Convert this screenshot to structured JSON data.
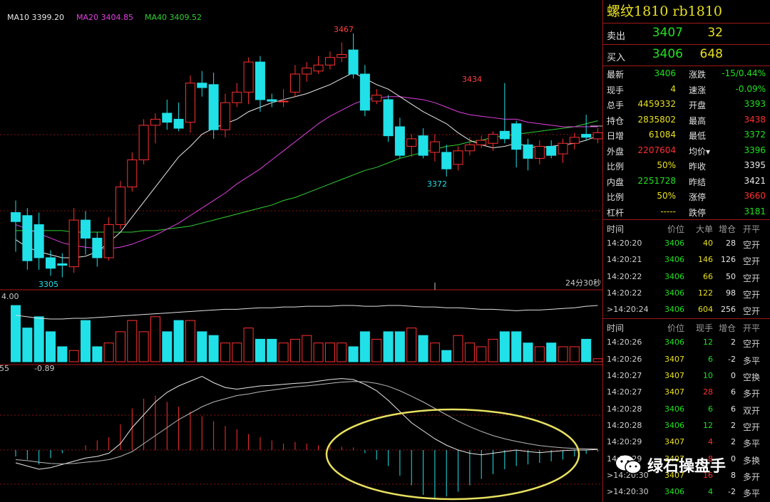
{
  "ma_labels": {
    "ma10": "MA10 3399.20",
    "ma20": "MA20 3404.85",
    "ma40": "MA40 3409.52"
  },
  "price_labels": {
    "high": "3467",
    "peak2": "3434",
    "low_mid": "3372",
    "low": "3305",
    "time_left": "24分30秒"
  },
  "volume_label": "4.00",
  "macd_labels": {
    "left": "55",
    "value": "-0.89"
  },
  "colors": {
    "up": "#ff3030",
    "down": "#20e0e8",
    "ma10": "#e8e8e8",
    "ma20": "#e040e0",
    "ma40": "#30d030",
    "grid": "#8a1010",
    "ellipse": "#e8e060"
  },
  "chart_data": {
    "type": "candlestick",
    "ylim": [
      3300,
      3475
    ],
    "candles": [
      {
        "o": 3348,
        "h": 3356,
        "l": 3322,
        "c": 3342
      },
      {
        "o": 3346,
        "h": 3351,
        "l": 3310,
        "c": 3316
      },
      {
        "o": 3340,
        "h": 3348,
        "l": 3310,
        "c": 3318
      },
      {
        "o": 3318,
        "h": 3323,
        "l": 3306,
        "c": 3311
      },
      {
        "o": 3314,
        "h": 3321,
        "l": 3305,
        "c": 3313
      },
      {
        "o": 3312,
        "h": 3351,
        "l": 3308,
        "c": 3343
      },
      {
        "o": 3343,
        "h": 3349,
        "l": 3320,
        "c": 3331
      },
      {
        "o": 3331,
        "h": 3335,
        "l": 3312,
        "c": 3318
      },
      {
        "o": 3318,
        "h": 3345,
        "l": 3316,
        "c": 3340
      },
      {
        "o": 3340,
        "h": 3369,
        "l": 3337,
        "c": 3365
      },
      {
        "o": 3365,
        "h": 3388,
        "l": 3362,
        "c": 3383
      },
      {
        "o": 3383,
        "h": 3410,
        "l": 3380,
        "c": 3406
      },
      {
        "o": 3406,
        "h": 3414,
        "l": 3394,
        "c": 3410
      },
      {
        "o": 3414,
        "h": 3423,
        "l": 3403,
        "c": 3408
      },
      {
        "o": 3410,
        "h": 3421,
        "l": 3402,
        "c": 3404
      },
      {
        "o": 3408,
        "h": 3439,
        "l": 3401,
        "c": 3434
      },
      {
        "o": 3434,
        "h": 3442,
        "l": 3425,
        "c": 3431
      },
      {
        "o": 3433,
        "h": 3441,
        "l": 3397,
        "c": 3403
      },
      {
        "o": 3403,
        "h": 3427,
        "l": 3398,
        "c": 3421
      },
      {
        "o": 3421,
        "h": 3434,
        "l": 3418,
        "c": 3428
      },
      {
        "o": 3428,
        "h": 3451,
        "l": 3420,
        "c": 3448
      },
      {
        "o": 3448,
        "h": 3452,
        "l": 3415,
        "c": 3423
      },
      {
        "o": 3423,
        "h": 3427,
        "l": 3418,
        "c": 3422
      },
      {
        "o": 3422,
        "h": 3430,
        "l": 3418,
        "c": 3422
      },
      {
        "o": 3428,
        "h": 3446,
        "l": 3425,
        "c": 3440
      },
      {
        "o": 3440,
        "h": 3448,
        "l": 3435,
        "c": 3444
      },
      {
        "o": 3442,
        "h": 3452,
        "l": 3440,
        "c": 3446
      },
      {
        "o": 3446,
        "h": 3455,
        "l": 3443,
        "c": 3451
      },
      {
        "o": 3451,
        "h": 3461,
        "l": 3448,
        "c": 3453
      },
      {
        "o": 3456,
        "h": 3467,
        "l": 3437,
        "c": 3440
      },
      {
        "o": 3440,
        "h": 3446,
        "l": 3412,
        "c": 3416
      },
      {
        "o": 3422,
        "h": 3430,
        "l": 3420,
        "c": 3426
      },
      {
        "o": 3423,
        "h": 3426,
        "l": 3395,
        "c": 3399
      },
      {
        "o": 3405,
        "h": 3411,
        "l": 3384,
        "c": 3386
      },
      {
        "o": 3392,
        "h": 3400,
        "l": 3385,
        "c": 3397
      },
      {
        "o": 3399,
        "h": 3404,
        "l": 3384,
        "c": 3386
      },
      {
        "o": 3388,
        "h": 3400,
        "l": 3382,
        "c": 3395
      },
      {
        "o": 3388,
        "h": 3393,
        "l": 3372,
        "c": 3377
      },
      {
        "o": 3380,
        "h": 3392,
        "l": 3376,
        "c": 3389
      },
      {
        "o": 3389,
        "h": 3398,
        "l": 3386,
        "c": 3393
      },
      {
        "o": 3393,
        "h": 3399,
        "l": 3391,
        "c": 3396
      },
      {
        "o": 3394,
        "h": 3402,
        "l": 3389,
        "c": 3400
      },
      {
        "o": 3402,
        "h": 3434,
        "l": 3394,
        "c": 3397
      },
      {
        "o": 3407,
        "h": 3409,
        "l": 3378,
        "c": 3390
      },
      {
        "o": 3393,
        "h": 3397,
        "l": 3376,
        "c": 3384
      },
      {
        "o": 3384,
        "h": 3396,
        "l": 3380,
        "c": 3392
      },
      {
        "o": 3392,
        "h": 3396,
        "l": 3384,
        "c": 3386
      },
      {
        "o": 3387,
        "h": 3397,
        "l": 3381,
        "c": 3394
      },
      {
        "o": 3394,
        "h": 3401,
        "l": 3390,
        "c": 3398
      },
      {
        "o": 3400,
        "h": 3413,
        "l": 3396,
        "c": 3398
      },
      {
        "o": 3397,
        "h": 3404,
        "l": 3394,
        "c": 3401
      }
    ],
    "ma10": [
      3330,
      3325,
      3322,
      3320,
      3318,
      3318,
      3319,
      3322,
      3328,
      3335,
      3345,
      3355,
      3365,
      3375,
      3385,
      3392,
      3400,
      3404,
      3407,
      3410,
      3415,
      3418,
      3421,
      3423,
      3425,
      3427,
      3430,
      3433,
      3437,
      3441,
      3437,
      3433,
      3430,
      3425,
      3420,
      3415,
      3411,
      3407,
      3401,
      3396,
      3393,
      3391,
      3392,
      3394,
      3392,
      3391,
      3392,
      3393,
      3394,
      3396,
      3399
    ],
    "ma20": [
      3340,
      3337,
      3334,
      3331,
      3328,
      3326,
      3325,
      3324,
      3324,
      3325,
      3327,
      3330,
      3333,
      3337,
      3341,
      3346,
      3351,
      3356,
      3361,
      3367,
      3372,
      3377,
      3383,
      3389,
      3395,
      3401,
      3407,
      3412,
      3416,
      3420,
      3423,
      3424,
      3425,
      3425,
      3424,
      3423,
      3421,
      3418,
      3415,
      3413,
      3412,
      3411,
      3410,
      3410,
      3408,
      3407,
      3406,
      3405,
      3405,
      3405,
      3405
    ],
    "ma40": [
      3336,
      3336,
      3336,
      3336,
      3336,
      3335,
      3335,
      3335,
      3335,
      3335,
      3335,
      3336,
      3336,
      3337,
      3338,
      3339,
      3341,
      3343,
      3345,
      3347,
      3349,
      3351,
      3353,
      3356,
      3358,
      3361,
      3364,
      3367,
      3370,
      3373,
      3376,
      3378,
      3381,
      3384,
      3386,
      3388,
      3390,
      3392,
      3393,
      3395,
      3396,
      3398,
      3399,
      3400,
      3401,
      3402,
      3403,
      3404,
      3405,
      3407,
      3409
    ],
    "volume": [
      75,
      45,
      60,
      40,
      20,
      15,
      55,
      20,
      25,
      40,
      55,
      40,
      60,
      40,
      55,
      55,
      40,
      35,
      25,
      25,
      45,
      30,
      30,
      25,
      30,
      35,
      25,
      25,
      25,
      20,
      40,
      30,
      40,
      40,
      45,
      35,
      25,
      15,
      35,
      25,
      20,
      30,
      40,
      40,
      25,
      20,
      25,
      20,
      20,
      30,
      4
    ],
    "vol_line": [
      62,
      60,
      58,
      57,
      57,
      58,
      58,
      59,
      60,
      61,
      62,
      63,
      64,
      65,
      66,
      67,
      68,
      69,
      70,
      70,
      71,
      72,
      72,
      73,
      73,
      74,
      74,
      74,
      75,
      75,
      74,
      74,
      75,
      75,
      74,
      73,
      73,
      72,
      72,
      71,
      70,
      70,
      69,
      68,
      69,
      69,
      70,
      71,
      72,
      74,
      75
    ],
    "dif": [
      -0.4,
      -0.5,
      -0.6,
      -0.55,
      -0.45,
      -0.35,
      -0.25,
      -0.2,
      -0.1,
      0.2,
      0.7,
      1.1,
      1.5,
      1.8,
      2.0,
      2.15,
      2.3,
      2.1,
      1.95,
      1.9,
      1.95,
      2.0,
      2.02,
      2.05,
      2.08,
      2.1,
      2.15,
      2.2,
      2.23,
      2.2,
      2.05,
      1.85,
      1.55,
      1.2,
      0.85,
      0.6,
      0.35,
      0.15,
      0.0,
      -0.1,
      -0.15,
      -0.1,
      -0.05,
      0.0,
      -0.05,
      -0.08,
      -0.05,
      -0.02,
      0.0,
      0.0,
      0.02
    ],
    "dea": [
      -0.3,
      -0.33,
      -0.38,
      -0.42,
      -0.43,
      -0.42,
      -0.38,
      -0.35,
      -0.3,
      -0.2,
      -0.05,
      0.2,
      0.45,
      0.7,
      0.95,
      1.15,
      1.35,
      1.5,
      1.6,
      1.7,
      1.75,
      1.82,
      1.87,
      1.92,
      1.97,
      2.0,
      2.04,
      2.08,
      2.12,
      2.14,
      2.13,
      2.08,
      1.99,
      1.85,
      1.68,
      1.5,
      1.3,
      1.1,
      0.9,
      0.73,
      0.58,
      0.45,
      0.35,
      0.27,
      0.2,
      0.14,
      0.1,
      0.07,
      0.05,
      0.04,
      0.03
    ],
    "macd_bar": [
      -0.2,
      -0.3,
      -0.45,
      -0.25,
      -0.1,
      0.0,
      0.15,
      0.3,
      0.4,
      0.8,
      1.3,
      1.6,
      1.7,
      1.5,
      1.35,
      1.2,
      1.05,
      0.9,
      0.75,
      0.65,
      0.5,
      0.4,
      0.3,
      0.2,
      0.25,
      0.2,
      0.15,
      0.12,
      0.1,
      0.08,
      -0.1,
      -0.3,
      -0.5,
      -0.8,
      -1.1,
      -1.4,
      -1.5,
      -1.45,
      -1.3,
      -1.1,
      -0.9,
      -0.75,
      -0.6,
      -0.5,
      -0.45,
      -0.4,
      -0.35,
      -0.3,
      -0.2,
      -0.12,
      -0.05
    ]
  },
  "panel": {
    "title": "螺纹1810 rb1810",
    "sell": {
      "label": "卖出",
      "price": "3407",
      "vol": "32"
    },
    "buy": {
      "label": "买入",
      "price": "3406",
      "vol": "648"
    },
    "stats": [
      {
        "l1": "最新",
        "v1": "3406",
        "c1": "green",
        "l2": "涨跌",
        "v2": "-15/0.44%",
        "c2": "green"
      },
      {
        "l1": "现手",
        "v1": "4",
        "c1": "yellow",
        "l2": "速涨",
        "v2": "-0.09%",
        "c2": "green"
      },
      {
        "l1": "总手",
        "v1": "4459332",
        "c1": "yellow",
        "l2": "开盘",
        "v2": "3393",
        "c2": "green"
      },
      {
        "l1": "持仓",
        "v1": "2835802",
        "c1": "yellow",
        "l2": "最高",
        "v2": "3438",
        "c2": "red"
      },
      {
        "l1": "日增",
        "v1": "61084",
        "c1": "yellow",
        "l2": "最低",
        "v2": "3372",
        "c2": "green"
      },
      {
        "l1": "外盘",
        "v1": "2207604",
        "c1": "red",
        "l2": "均价▾",
        "v2": "3396",
        "c2": "green"
      },
      {
        "l1": "比例",
        "v1": "50%",
        "c1": "yellow",
        "l2": "昨收",
        "v2": "3395",
        "c2": "white"
      },
      {
        "l1": "内盘",
        "v1": "2251728",
        "c1": "green",
        "l2": "昨结",
        "v2": "3421",
        "c2": "white"
      },
      {
        "l1": "比例",
        "v1": "50%",
        "c1": "yellow",
        "l2": "涨停",
        "v2": "3660",
        "c2": "red"
      },
      {
        "l1": "杠杆",
        "v1": "-----",
        "c1": "yellow",
        "l2": "跌停",
        "v2": "3181",
        "c2": "green"
      }
    ],
    "table1_headers": [
      "时间",
      "价位",
      "大单",
      "增仓",
      "开平"
    ],
    "table1": [
      {
        "t": "14:20:20",
        "p": "3406",
        "a": "40",
        "b": "28",
        "k": "空开"
      },
      {
        "t": "14:20:21",
        "p": "3406",
        "a": "146",
        "b": "126",
        "k": "空开"
      },
      {
        "t": "14:20:22",
        "p": "3406",
        "a": "66",
        "b": "50",
        "k": "空开"
      },
      {
        "t": "14:20:22",
        "p": "3406",
        "a": "122",
        "b": "98",
        "k": "空开"
      },
      {
        "t": ">14:20:24",
        "p": "3406",
        "a": "604",
        "b": "256",
        "k": "空开"
      }
    ],
    "table2_headers": [
      "时间",
      "价位",
      "现手",
      "增仓",
      "开平"
    ],
    "table2": [
      {
        "t": "14:20:26",
        "p": "3406",
        "a": "12",
        "ac": "green",
        "b": "2",
        "k": "空开"
      },
      {
        "t": "14:20:26",
        "p": "3407",
        "a": "6",
        "ac": "green",
        "b": "-2",
        "k": "多平"
      },
      {
        "t": "14:20:27",
        "p": "3407",
        "a": "10",
        "ac": "green",
        "b": "0",
        "k": "空换"
      },
      {
        "t": "14:20:27",
        "p": "3407",
        "a": "28",
        "ac": "red",
        "b": "6",
        "k": "多开"
      },
      {
        "t": "14:20:28",
        "p": "3406",
        "a": "6",
        "ac": "green",
        "b": "6",
        "k": "双开"
      },
      {
        "t": "14:20:28",
        "p": "3406",
        "a": "12",
        "ac": "green",
        "b": "2",
        "k": "空开"
      },
      {
        "t": "14:20:29",
        "p": "3407",
        "a": "4",
        "ac": "red",
        "b": "2",
        "k": "多平"
      },
      {
        "t": "14:20:29",
        "p": "3407",
        "a": "8",
        "ac": "red",
        "b": "0",
        "k": "多换"
      },
      {
        "t": ">14:20:30",
        "p": "3407",
        "a": "16",
        "ac": "red",
        "b": "8",
        "k": "多开"
      },
      {
        "t": ">14:20:30",
        "p": "3406",
        "a": "4",
        "ac": "green",
        "b": "-2",
        "k": "多平"
      }
    ]
  },
  "watermark": "绿石操盘手"
}
